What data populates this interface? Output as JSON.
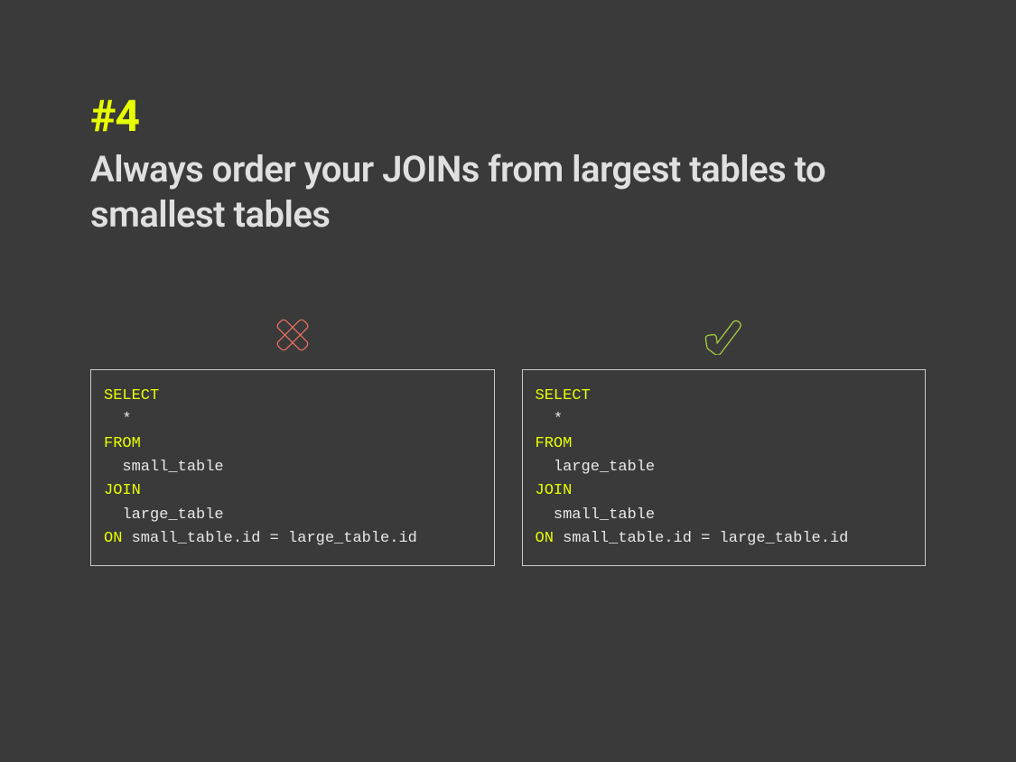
{
  "tip": {
    "number": "#4",
    "title": "Always order your JOINs from largest tables to smallest tables"
  },
  "left": {
    "icon": "cross-icon",
    "code": {
      "kw_select": "SELECT",
      "star": "  *",
      "kw_from": "FROM",
      "from_tbl": "  small_table",
      "kw_join": "JOIN",
      "join_tbl": "  large_table",
      "kw_on": "ON",
      "on_rest": " small_table.id = large_table.id"
    }
  },
  "right": {
    "icon": "check-icon",
    "code": {
      "kw_select": "SELECT",
      "star": "  *",
      "kw_from": "FROM",
      "from_tbl": "  large_table",
      "kw_join": "JOIN",
      "join_tbl": "  small_table",
      "kw_on": "ON",
      "on_rest": " small_table.id = large_table.id"
    }
  },
  "colors": {
    "accent": "#e8ff00",
    "cross": "#e87060",
    "check": "#a8d040"
  }
}
